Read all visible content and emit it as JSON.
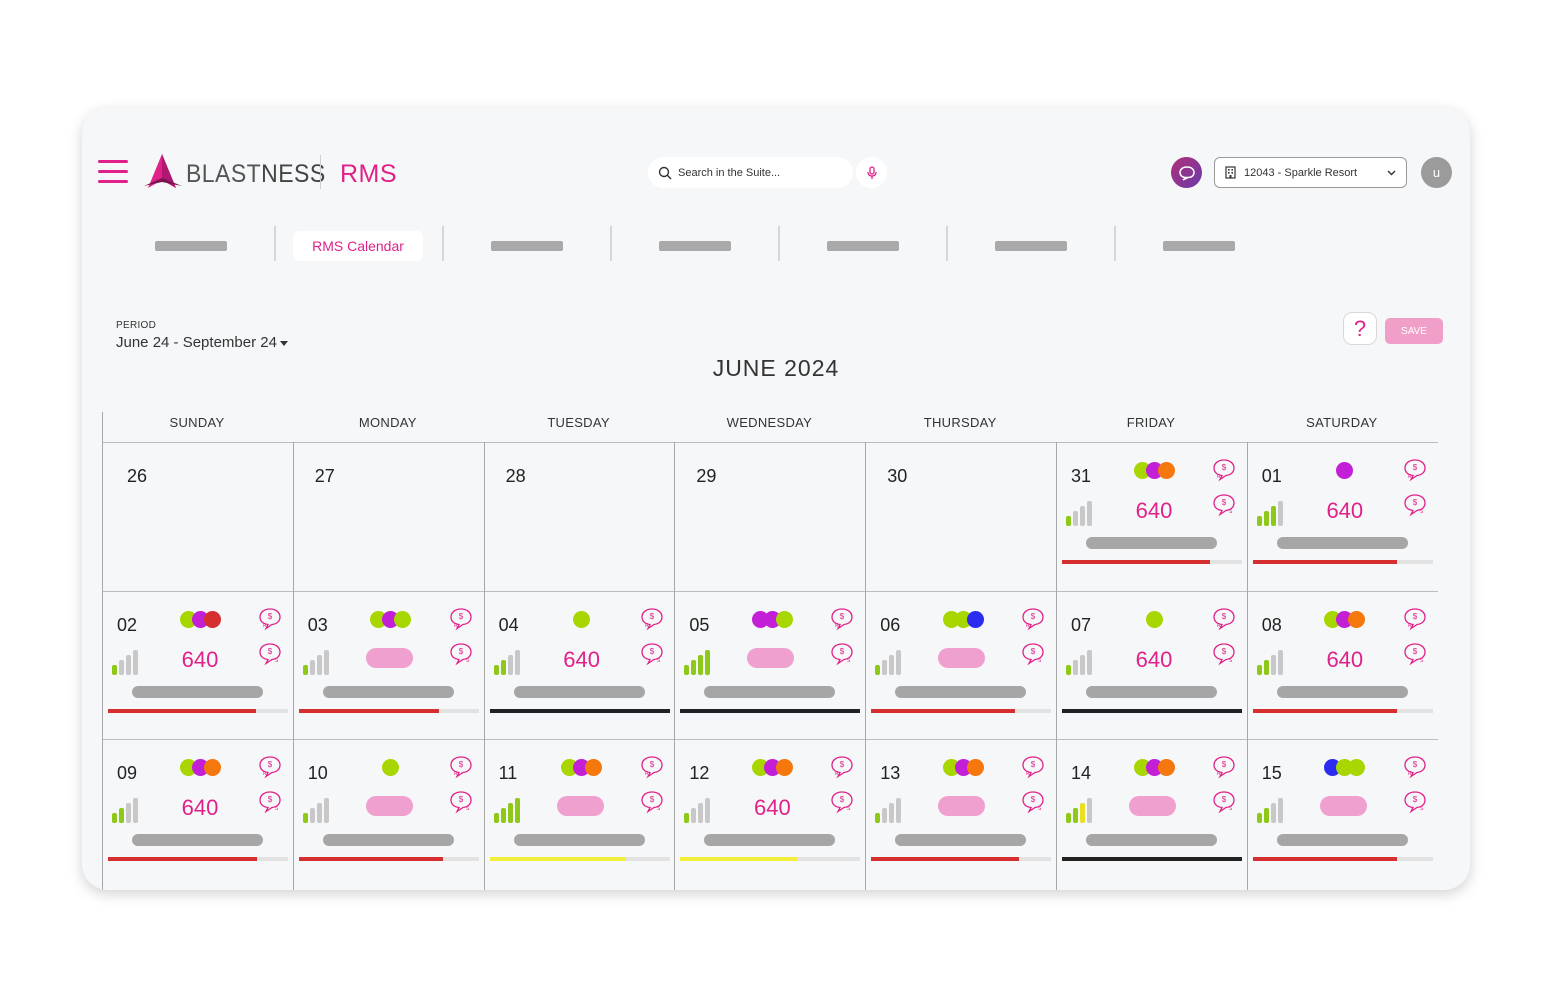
{
  "header": {
    "logo_text_light": "BLAST",
    "logo_text_bold": "NESS",
    "app_name": "RMS",
    "search_placeholder": "Search in the Suite...",
    "property": "12043 - Sparkle Resort",
    "avatar_initial": "u"
  },
  "tabs": [
    {
      "label": "",
      "active": false
    },
    {
      "label": "RMS Calendar",
      "active": true
    },
    {
      "label": "",
      "active": false
    },
    {
      "label": "",
      "active": false
    },
    {
      "label": "",
      "active": false
    },
    {
      "label": "",
      "active": false
    },
    {
      "label": "",
      "active": false
    }
  ],
  "period": {
    "label": "PERIOD",
    "value": "June 24 - September 24"
  },
  "help_label": "?",
  "save_label": "SAVE",
  "month_title": "JUNE 2024",
  "weekdays": [
    "SUNDAY",
    "MONDAY",
    "TUESDAY",
    "WEDNESDAY",
    "THURSDAY",
    "FRIDAY",
    "SATURDAY"
  ],
  "colors": {
    "accent": "#e0218a",
    "pill": "#f0a0cf",
    "green": "#a8d600",
    "magenta": "#c21fd6",
    "orange": "#f5780f",
    "red": "#d62f2f",
    "blue": "#2c2cf0",
    "bar_green": "#8ec919",
    "bar_grey": "#c8c8c8",
    "bar_yellow": "#e8e020",
    "track_red": "#d62f2f",
    "track_black": "#222222",
    "track_yellow": "#f2ee3a"
  },
  "weeks": [
    [
      {
        "day": "26",
        "empty": true
      },
      {
        "day": "27",
        "empty": true
      },
      {
        "day": "28",
        "empty": true
      },
      {
        "day": "29",
        "empty": true
      },
      {
        "day": "30",
        "empty": true
      },
      {
        "day": "31",
        "dots": [
          "green",
          "magenta",
          "orange"
        ],
        "value": "640",
        "bars": 1,
        "bar_color": "green",
        "track_color": "red",
        "track_fill": 0.82
      },
      {
        "day": "01",
        "dots": [
          "magenta"
        ],
        "value": "640",
        "bars": 3,
        "bar_color": "green",
        "track_color": "red",
        "track_fill": 0.8
      }
    ],
    [
      {
        "day": "02",
        "dots": [
          "green",
          "magenta",
          "red"
        ],
        "value": "640",
        "bars": 1,
        "bar_color": "green",
        "track_color": "red",
        "track_fill": 0.82
      },
      {
        "day": "03",
        "dots": [
          "green",
          "magenta",
          "green"
        ],
        "value": "",
        "bars": 1,
        "bar_color": "green",
        "track_color": "red",
        "track_fill": 0.78
      },
      {
        "day": "04",
        "dots": [
          "green"
        ],
        "value": "640",
        "bars": 2,
        "bar_color": "green",
        "track_color": "black",
        "track_fill": 1.0
      },
      {
        "day": "05",
        "dots": [
          "magenta",
          "magenta",
          "green"
        ],
        "value": "",
        "bars": 4,
        "bar_color": "green",
        "track_color": "black",
        "track_fill": 1.0
      },
      {
        "day": "06",
        "dots": [
          "green",
          "green",
          "blue"
        ],
        "value": "",
        "bars": 1,
        "bar_color": "green",
        "track_color": "red",
        "track_fill": 0.8
      },
      {
        "day": "07",
        "dots": [
          "green"
        ],
        "value": "640",
        "bars": 1,
        "bar_color": "green",
        "track_color": "black",
        "track_fill": 1.0
      },
      {
        "day": "08",
        "dots": [
          "green",
          "magenta",
          "orange"
        ],
        "value": "640",
        "bars": 2,
        "bar_color": "green",
        "track_color": "red",
        "track_fill": 0.8
      }
    ],
    [
      {
        "day": "09",
        "dots": [
          "green",
          "magenta",
          "orange"
        ],
        "value": "640",
        "bars": 2,
        "bar_color": "green",
        "track_color": "red",
        "track_fill": 0.83
      },
      {
        "day": "10",
        "dots": [
          "green"
        ],
        "value": "",
        "bars": 1,
        "bar_color": "green",
        "track_color": "red",
        "track_fill": 0.8
      },
      {
        "day": "11",
        "dots": [
          "green",
          "magenta",
          "orange"
        ],
        "value": "",
        "bars": 4,
        "bar_color": "green",
        "track_color": "yellow",
        "track_fill": 0.76
      },
      {
        "day": "12",
        "dots": [
          "green",
          "magenta",
          "orange"
        ],
        "value": "640",
        "bars": 1,
        "bar_color": "green",
        "track_color": "yellow",
        "track_fill": 0.65
      },
      {
        "day": "13",
        "dots": [
          "green",
          "magenta",
          "orange"
        ],
        "value": "",
        "bars": 1,
        "bar_color": "green",
        "track_color": "red",
        "track_fill": 0.82
      },
      {
        "day": "14",
        "dots": [
          "green",
          "magenta",
          "orange"
        ],
        "value": "",
        "bars": 3,
        "bar_color": "yellow",
        "track_color": "black",
        "track_fill": 1.0
      },
      {
        "day": "15",
        "dots": [
          "blue",
          "green",
          "green"
        ],
        "value": "",
        "bars": 2,
        "bar_color": "green",
        "track_color": "red",
        "track_fill": 0.8
      }
    ]
  ]
}
